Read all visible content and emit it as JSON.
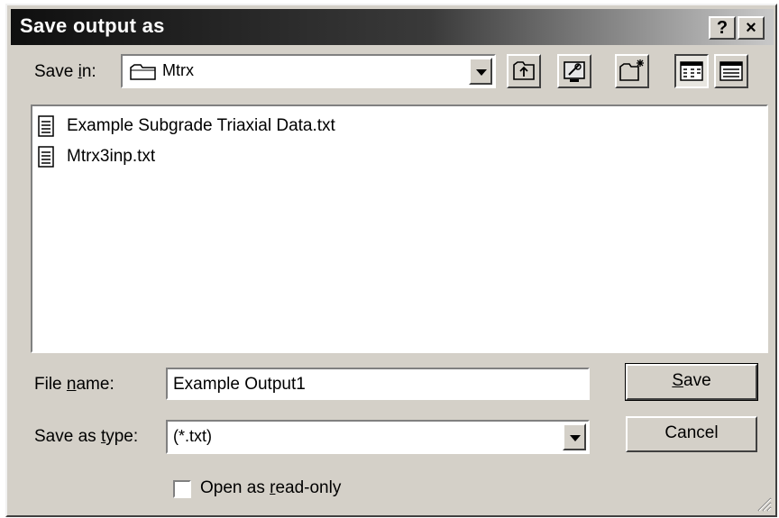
{
  "window": {
    "title": "Save output as",
    "help_label": "?",
    "close_label": "×"
  },
  "save_in": {
    "label_pre": "Save ",
    "label_u": "i",
    "label_post": "n:",
    "value": "Mtrx"
  },
  "toolbar": {
    "up_one_level": "up-folder-icon",
    "desktop": "desktop-icon",
    "new_folder": "new-folder-icon",
    "list_view": "list-view-icon",
    "details_view": "details-view-icon"
  },
  "files": [
    {
      "name": "Example Subgrade Triaxial Data.txt"
    },
    {
      "name": "Mtrx3inp.txt"
    }
  ],
  "file_name": {
    "label_pre": "File ",
    "label_u": "n",
    "label_post": "ame:",
    "value": "Example Output1"
  },
  "save_type": {
    "label_pre": "Save as ",
    "label_u": "t",
    "label_post": "ype:",
    "value": "(*.txt)"
  },
  "buttons": {
    "save_u": "S",
    "save_rest": "ave",
    "cancel": "Cancel"
  },
  "read_only": {
    "label_pre": "Open as ",
    "label_u": "r",
    "label_post": "ead-only",
    "checked": false
  }
}
